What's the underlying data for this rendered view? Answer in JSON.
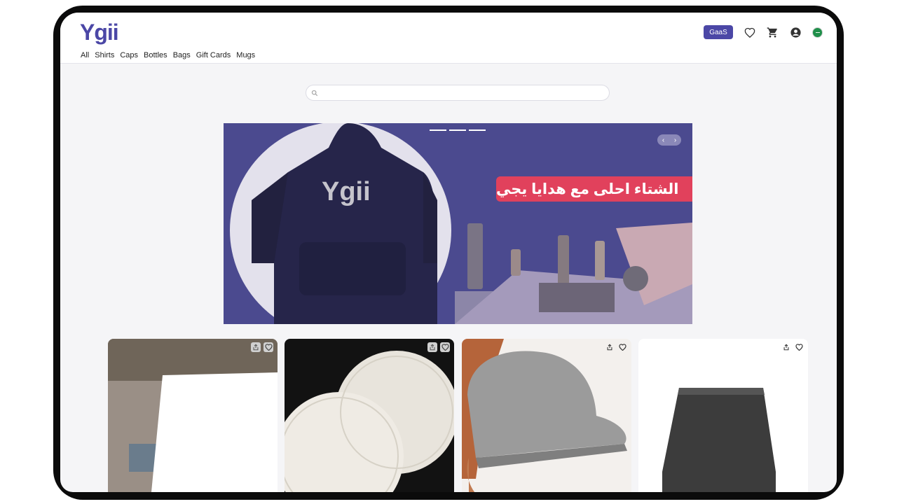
{
  "brand": {
    "logo": "Ygii"
  },
  "nav": [
    "All",
    "Shirts",
    "Caps",
    "Bottles",
    "Bags",
    "Gift Cards",
    "Mugs"
  ],
  "header": {
    "gaas_label": "GaaS"
  },
  "search": {
    "placeholder": ""
  },
  "hero": {
    "tagline": "الشتاء احلى مع هدايا يجي",
    "hoodie_print": "Ygii"
  },
  "products": [
    {
      "image": "white-card-blurred-background"
    },
    {
      "image": "white-embossed-coasters"
    },
    {
      "image": "grey-baseball-cap"
    },
    {
      "image": "black-tumbler"
    }
  ],
  "colors": {
    "accent": "#4b47a6",
    "banner_bg": "#4b4a8f",
    "tagline_bg": "#e1415c"
  }
}
